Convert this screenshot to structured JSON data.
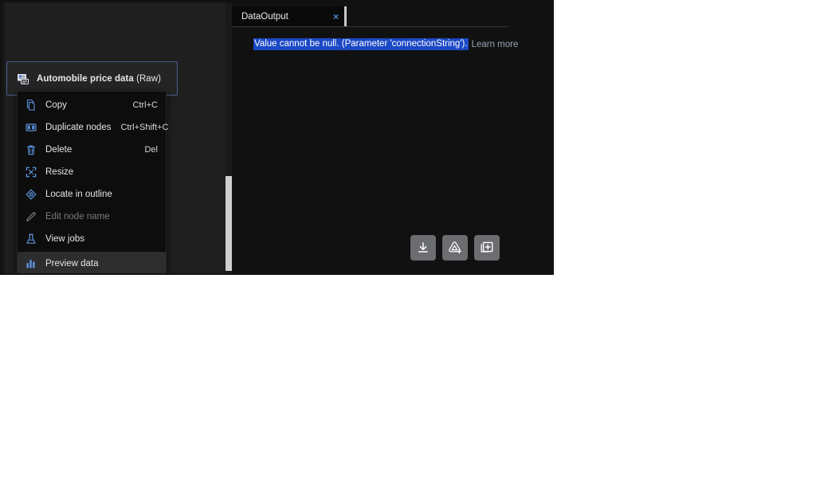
{
  "app": {
    "background_color": "#111111",
    "canvas_color": "#1f1f1f"
  },
  "canvas": {
    "node": {
      "title_main": "Automobile price data",
      "title_suffix": " (Raw)",
      "icon": "dataset-node-icon",
      "border_color": "#4d5e8f"
    },
    "scrollbar": {
      "orientation": "vertical",
      "thumb_color": "#cfcfcf"
    }
  },
  "context_menu": {
    "items": [
      {
        "label": "Copy",
        "shortcut": "Ctrl+C",
        "icon": "copy-icon",
        "disabled": false,
        "hovered": false,
        "separated": false
      },
      {
        "label": "Duplicate nodes",
        "shortcut": "Ctrl+Shift+C",
        "icon": "duplicate-icon",
        "disabled": false,
        "hovered": false,
        "separated": false
      },
      {
        "label": "Delete",
        "shortcut": "Del",
        "icon": "trash-icon",
        "disabled": false,
        "hovered": false,
        "separated": false
      },
      {
        "label": "Resize",
        "shortcut": "",
        "icon": "resize-icon",
        "disabled": false,
        "hovered": false,
        "separated": false
      },
      {
        "label": "Locate in outline",
        "shortcut": "",
        "icon": "locate-icon",
        "disabled": false,
        "hovered": false,
        "separated": false
      },
      {
        "label": "Edit node name",
        "shortcut": "",
        "icon": "pencil-icon",
        "disabled": true,
        "hovered": false,
        "separated": false
      },
      {
        "label": "View jobs",
        "shortcut": "",
        "icon": "flask-icon",
        "disabled": false,
        "hovered": false,
        "separated": false
      },
      {
        "label": "Preview data",
        "shortcut": "",
        "icon": "bar-chart-icon",
        "disabled": false,
        "hovered": true,
        "separated": true
      }
    ]
  },
  "output_panel": {
    "tabs": [
      {
        "label": "DataOutput",
        "active": true,
        "close_label": "×"
      }
    ],
    "message": {
      "text": "Value cannot be null. (Parameter 'connectionString').",
      "link_label": "Learn more",
      "highlight_color": "#1b48c4"
    },
    "actions": [
      {
        "name": "download-button",
        "icon": "download-icon"
      },
      {
        "name": "register-button",
        "icon": "azure-add-icon"
      },
      {
        "name": "add-to-page-button",
        "icon": "add-page-icon"
      }
    ]
  }
}
